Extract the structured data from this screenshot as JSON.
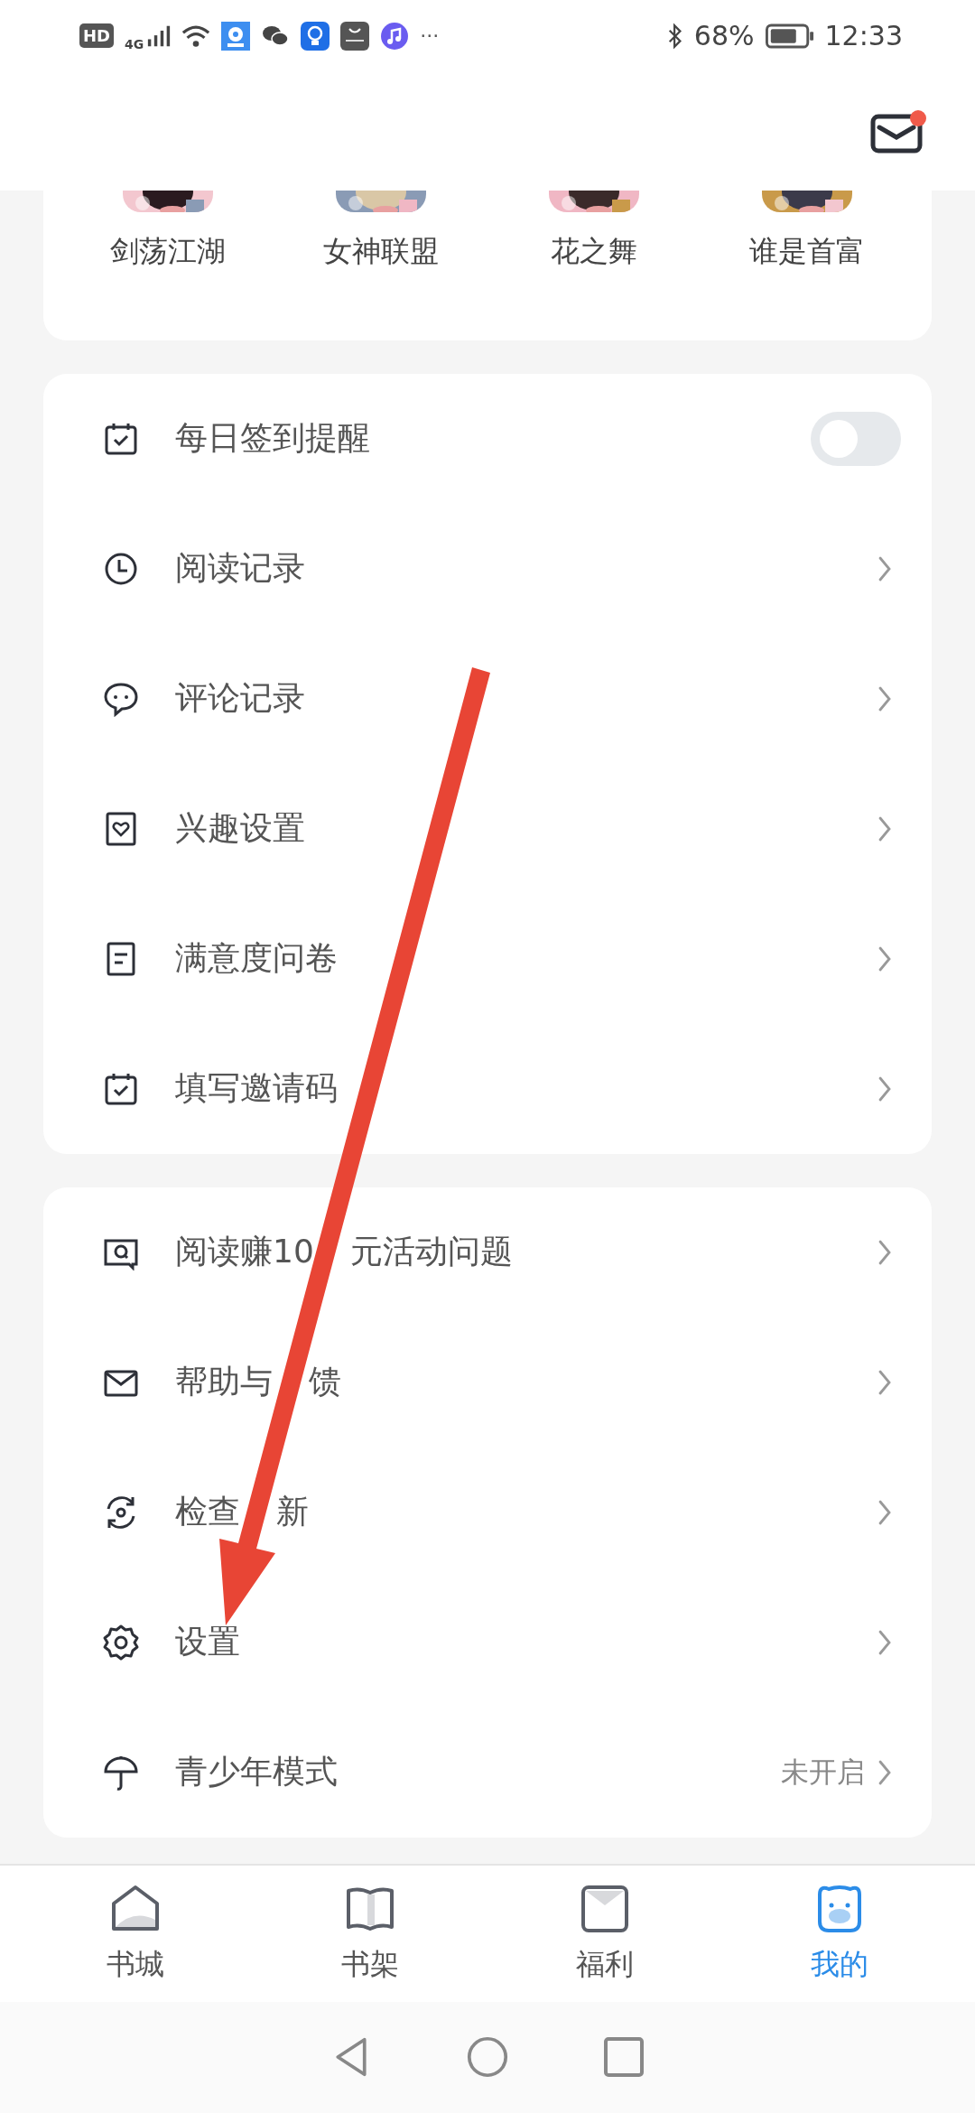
{
  "status_bar": {
    "hd": "HD",
    "network": "4G",
    "more": "···",
    "battery": "68%",
    "time": "12:33"
  },
  "header": {
    "mail_unread": true
  },
  "books": [
    {
      "title": "剑荡江湖"
    },
    {
      "title": "女神联盟"
    },
    {
      "title": "花之舞"
    },
    {
      "title": "谁是首富"
    }
  ],
  "menu_groups": [
    {
      "items": [
        {
          "kind": "toggle",
          "label": "每日签到提醒",
          "on": false
        },
        {
          "kind": "link",
          "label": "阅读记录"
        },
        {
          "kind": "link",
          "label": "评论记录"
        },
        {
          "kind": "link",
          "label": "兴趣设置"
        },
        {
          "kind": "link",
          "label": "满意度问卷"
        },
        {
          "kind": "link",
          "label": "填写邀请码"
        }
      ]
    },
    {
      "items": [
        {
          "kind": "link",
          "label": "阅读赚10",
          "label_after_arrow": "元活动问题"
        },
        {
          "kind": "link",
          "label": "帮助与",
          "label_after_arrow": "馈"
        },
        {
          "kind": "link",
          "label": "检查",
          "label_after_arrow": "新"
        },
        {
          "kind": "link",
          "label": "设置"
        },
        {
          "kind": "link",
          "label": "青少年模式",
          "value": "未开启"
        }
      ]
    }
  ],
  "tabs": [
    {
      "label": "书城",
      "selected": false
    },
    {
      "label": "书架",
      "selected": false
    },
    {
      "label": "福利",
      "selected": false
    },
    {
      "label": "我的",
      "selected": true
    }
  ]
}
